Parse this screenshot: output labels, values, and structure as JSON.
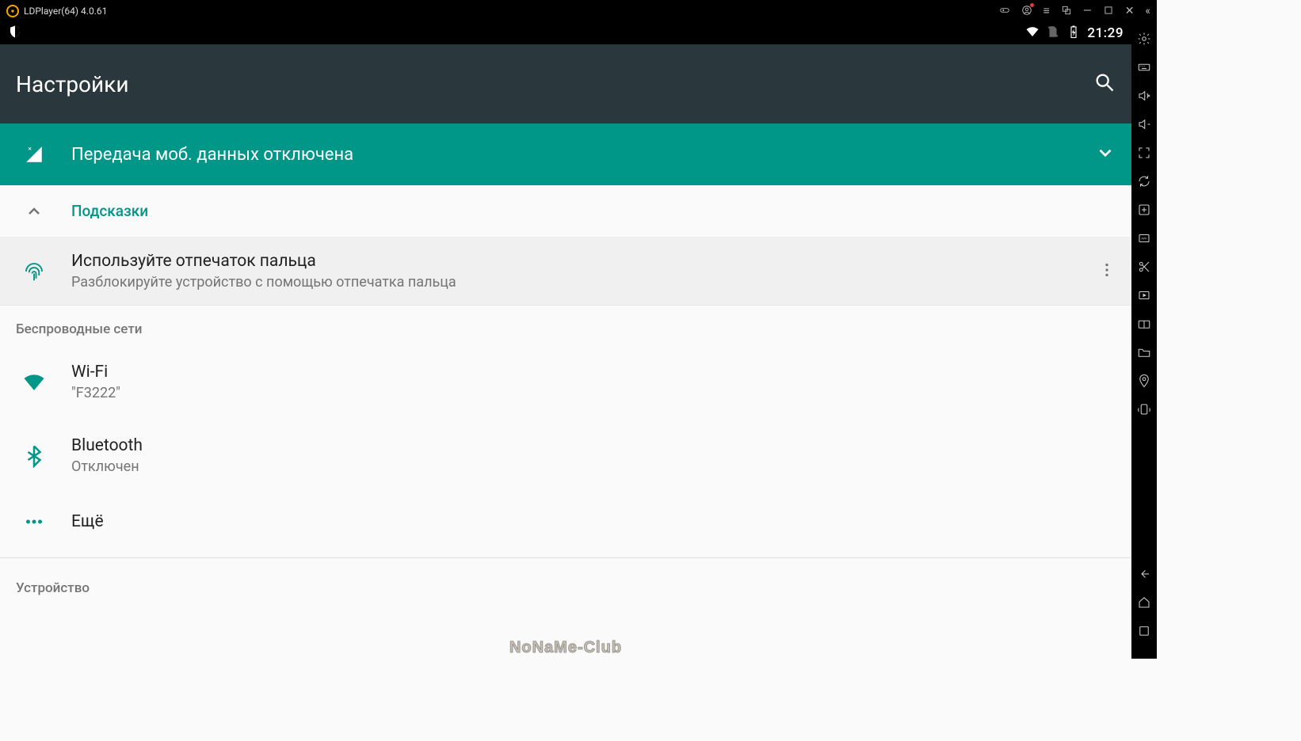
{
  "emulator": {
    "title": "LDPlayer(64) 4.0.61"
  },
  "status": {
    "time": "21:29"
  },
  "appbar": {
    "title": "Настройки"
  },
  "banner": {
    "text": "Передача моб. данных отключена"
  },
  "hints": {
    "header": "Подсказки",
    "fingerprint": {
      "title": "Используйте отпечаток пальца",
      "sub": "Разблокируйте устройство с помощью отпечатка пальца"
    }
  },
  "sections": {
    "wireless": {
      "title": "Беспроводные сети",
      "wifi": {
        "title": "Wi-Fi",
        "sub": "\"F3222\""
      },
      "bluetooth": {
        "title": "Bluetooth",
        "sub": "Отключен"
      },
      "more": {
        "title": "Ещё"
      }
    },
    "device": {
      "title": "Устройство"
    }
  },
  "watermark": "NoNaMe-Club"
}
